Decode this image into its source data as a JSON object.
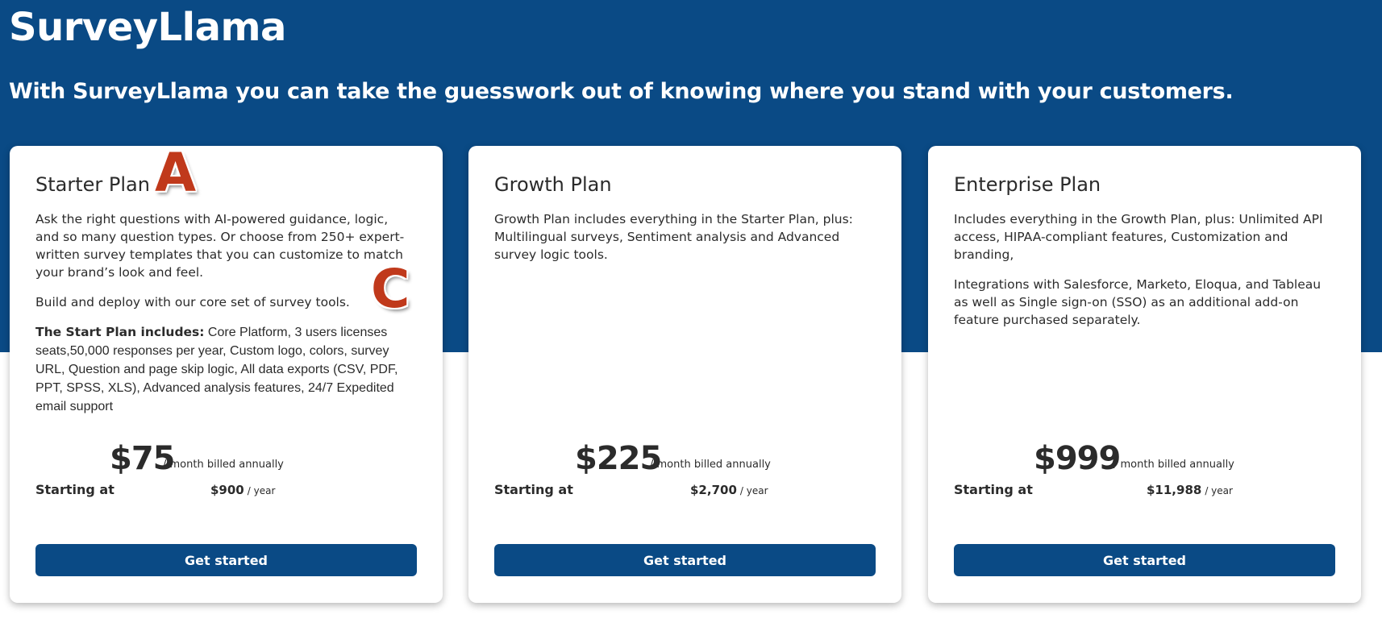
{
  "header": {
    "brand": "SurveyLlama",
    "tagline": "With SurveyLlama you can take the guesswork out of knowing where you stand with your customers."
  },
  "plans": [
    {
      "title": "Starter Plan",
      "description": [
        "Ask the right questions with AI-powered guidance, logic, and so many question types. Or choose from 250+ expert-written survey templates that you can customize to match your brand’s look and feel.",
        "Build and deploy with our core set of survey tools."
      ],
      "includes_label": "The Start Plan includes:",
      "includes_text": " Core Platform, 3 users licenses seats,50,000 responses per year, Custom logo, colors, survey URL, Question and page skip logic, All data exports (CSV, PDF, PPT, SPSS, XLS), Advanced analysis features, 24/7 Expedited email support",
      "price_monthly": "$75",
      "billing_note": "/ month billed annually",
      "starting_label": "Starting at",
      "price_yearly": "$900",
      "per_year": "/ year",
      "cta": "Get started"
    },
    {
      "title": "Growth Plan",
      "description": [
        "Growth Plan includes everything in the Starter Plan, plus: Multilingual surveys, Sentiment analysis and Advanced survey logic tools."
      ],
      "price_monthly": "$225",
      "billing_note": "/ month billed annually",
      "starting_label": "Starting at",
      "price_yearly": "$2,700",
      "per_year": "/ year",
      "cta": "Get started"
    },
    {
      "title": "Enterprise Plan",
      "description": [
        "Includes everything in the Growth Plan, plus: Unlimited API access, HIPAA-compliant features, Customization and branding,",
        "Integrations with Salesforce, Marketo, Eloqua, and Tableau as well as Single sign-on (SSO) as an additional add-on feature purchased separately."
      ],
      "price_monthly": "$999",
      "billing_note": "/ month billed annually",
      "starting_label": "Starting at",
      "price_yearly": "$11,988",
      "per_year": "/ year",
      "cta": "Get started"
    }
  ],
  "annotations": {
    "badge_a": "A",
    "badge_c": "C"
  },
  "colors": {
    "brand_blue": "#0a4a85",
    "badge_red": "#c0391b",
    "text": "#2b2b2b"
  }
}
